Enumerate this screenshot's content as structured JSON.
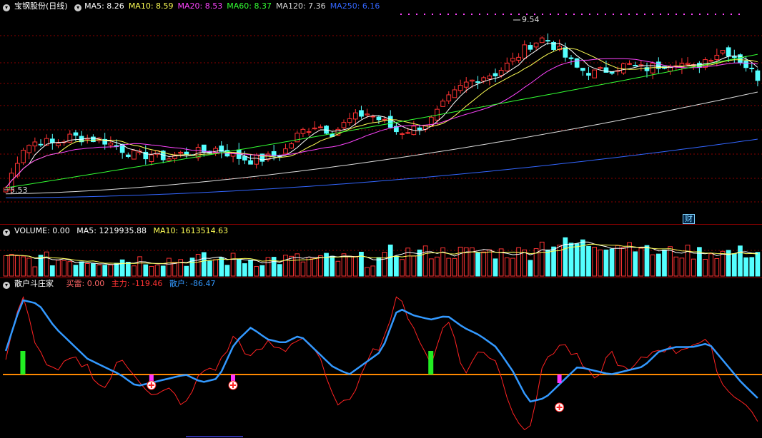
{
  "header": {
    "stock_name": "宝钢股份(日线)",
    "ma": [
      {
        "label": "MA5: 8.26",
        "color": "#ffffff"
      },
      {
        "label": "MA10: 8.59",
        "color": "#ffff55"
      },
      {
        "label": "MA20: 8.53",
        "color": "#ff44ff"
      },
      {
        "label": "MA60: 8.37",
        "color": "#33ff33"
      },
      {
        "label": "MA120: 7.36",
        "color": "#dddddd"
      },
      {
        "label": "MA250: 6.16",
        "color": "#3366ff"
      }
    ]
  },
  "price_panel": {
    "high_label": "9.54",
    "low_label": "5.53",
    "badge": "财"
  },
  "volume_panel": {
    "title": "VOLUME: 0.00",
    "ma5": "MA5: 1219935.88",
    "ma10": "MA10: 1613514.63"
  },
  "indicator_panel": {
    "title": "散户斗庄家",
    "buy": "买雷: 0.00",
    "main": "主力: -119.46",
    "retail": "散户: -86.47"
  },
  "colors": {
    "up": "#ff3333",
    "down": "#54ffff",
    "grid": "#8b0000",
    "ma5": "#ffffff",
    "ma10": "#ffff55",
    "ma20": "#ff44ff",
    "ma60": "#33ff33",
    "ma120": "#dddddd",
    "ma250": "#3366ff",
    "retail_line": "#3399ff",
    "main_line": "#ff2222",
    "zero_line": "#ff8800"
  },
  "series": {
    "close_trend": [
      5.6,
      6.6,
      6.8,
      6.7,
      6.9,
      6.85,
      6.8,
      6.6,
      6.4,
      6.45,
      6.35,
      6.5,
      6.5,
      6.6,
      6.4,
      6.3,
      6.35,
      6.5,
      7.0,
      7.2,
      7.0,
      7.3,
      7.5,
      7.3,
      7.0,
      7.1,
      7.3,
      7.8,
      8.2,
      8.4,
      8.5,
      8.8,
      9.2,
      9.4,
      9.0,
      8.6,
      8.5,
      8.6,
      8.7,
      8.6,
      8.7,
      8.8,
      8.6,
      8.9,
      9.1,
      8.8,
      8.4
    ],
    "retail_line": [
      0.3,
      0.95,
      0.9,
      0.6,
      0.4,
      0.2,
      0.1,
      0.0,
      -0.15,
      -0.1,
      -0.05,
      0.0,
      -0.1,
      -0.05,
      0.4,
      0.6,
      0.45,
      0.4,
      0.5,
      0.3,
      0.1,
      0.0,
      0.15,
      0.3,
      0.85,
      0.75,
      0.7,
      0.75,
      0.6,
      0.5,
      0.35,
      0.05,
      -0.35,
      -0.3,
      -0.1,
      0.1,
      0.05,
      0.0,
      0.05,
      0.1,
      0.3,
      0.35,
      0.35,
      0.4,
      0.15,
      -0.1,
      -0.3
    ],
    "main_line": [
      0.2,
      1.0,
      0.3,
      0.0,
      0.2,
      0.1,
      -0.2,
      0.2,
      0.0,
      -0.3,
      -0.2,
      -0.4,
      0.05,
      0.1,
      0.5,
      0.2,
      0.4,
      0.3,
      0.5,
      0.3,
      -0.3,
      -0.4,
      0.2,
      0.4,
      1.0,
      0.6,
      0.1,
      0.8,
      0.0,
      0.3,
      0.2,
      -0.5,
      -0.7,
      0.2,
      0.4,
      0.2,
      -0.1,
      0.3,
      0.0,
      0.2,
      0.35,
      0.3,
      0.4,
      0.4,
      -0.2,
      -0.3,
      -0.6
    ],
    "green_bars_idx": [
      1,
      26
    ],
    "buy_markers_idx": [
      9,
      14,
      34
    ]
  }
}
